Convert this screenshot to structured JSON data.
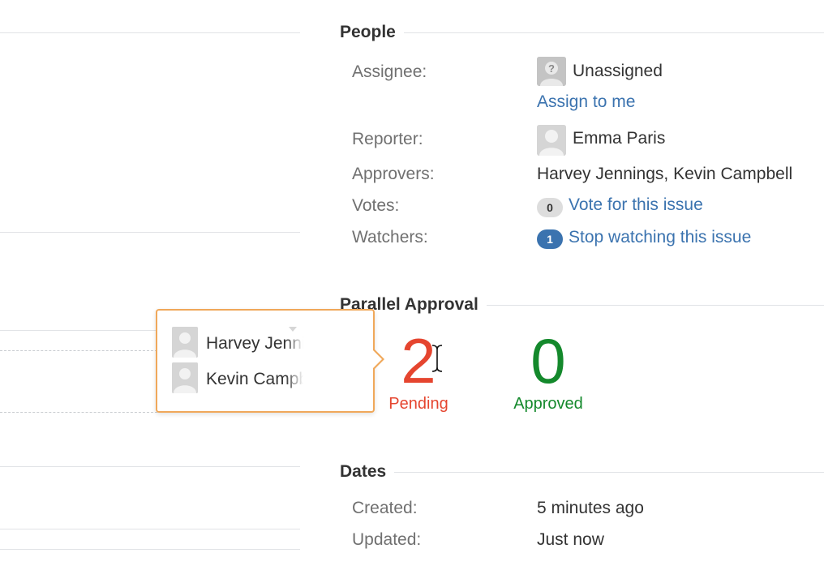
{
  "people": {
    "title": "People",
    "assignee_label": "Assignee:",
    "assignee_value": "Unassigned",
    "assign_to_me": "Assign to me",
    "reporter_label": "Reporter:",
    "reporter_value": "Emma Paris",
    "approvers_label": "Approvers:",
    "approvers_value": "Harvey Jennings, Kevin Campbell",
    "votes_label": "Votes:",
    "votes_count": "0",
    "votes_link": "Vote for this issue",
    "watchers_label": "Watchers:",
    "watchers_count": "1",
    "watchers_link": "Stop watching this issue"
  },
  "approval": {
    "title": "Parallel Approval",
    "pending_count": "2",
    "pending_label": "Pending",
    "approved_count": "0",
    "approved_label": "Approved",
    "pending_color": "#e5452f",
    "approved_color": "#14892c"
  },
  "popup": {
    "names": [
      "Harvey Jennings",
      "Kevin Campbell"
    ],
    "border_color": "#f0a85a"
  },
  "dates": {
    "title": "Dates",
    "created_label": "Created:",
    "created_value": "5 minutes ago",
    "updated_label": "Updated:",
    "updated_value": "Just now"
  },
  "icons": {
    "unknown_avatar": "unknown-user-avatar-icon",
    "user_avatar": "user-avatar-icon",
    "text_cursor": "text-cursor-icon"
  },
  "colors": {
    "link": "#3b73af",
    "label": "#707070",
    "rule": "#e1e3e6"
  }
}
